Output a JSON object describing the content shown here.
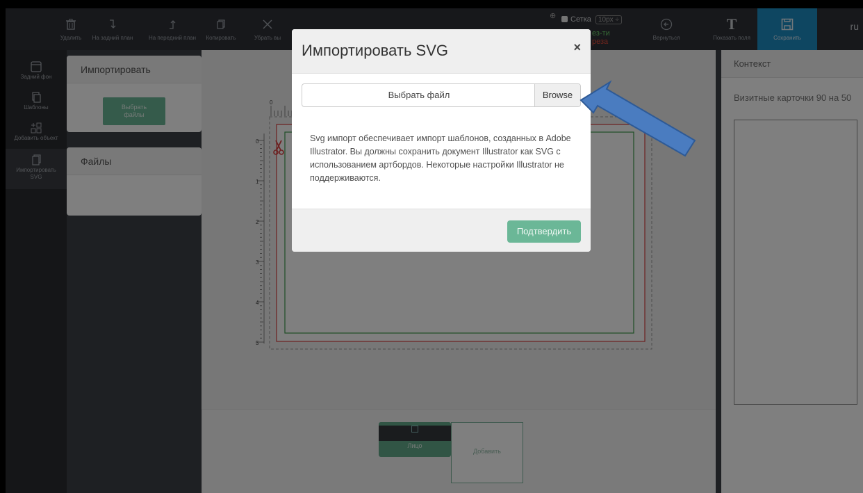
{
  "toolbar": {
    "delete": "Удалить",
    "to_back": "На задний план",
    "to_front": "На передний план",
    "copy": "Копировать",
    "remove": "Убрать вы",
    "grid_label": "Сетка",
    "grid_size": "10px ÷",
    "bleed_line1": "ез-ти",
    "bleed_line2": "реза",
    "bleed_colors": {
      "line1": "#6bd06b",
      "line2": "#e24a3b"
    },
    "back": "Вернуться",
    "show_fields": "Показать поля",
    "save": "Сохранить",
    "language": "ru"
  },
  "sidebar": {
    "items": [
      {
        "label": "Задний фон",
        "icon": "background-icon"
      },
      {
        "label": "Шаблоны",
        "icon": "templates-icon"
      },
      {
        "label": "Добавить объект",
        "icon": "add-object-icon"
      },
      {
        "label": "Импортировать SVG",
        "icon": "import-svg-icon"
      }
    ]
  },
  "left_panel": {
    "import_title": "Импортировать",
    "choose_files": "Выбрать файлы",
    "files_title": "Файлы"
  },
  "canvas": {
    "ruler_numbers": [
      "0",
      "1",
      "2",
      "3",
      "4",
      "5"
    ],
    "pages": [
      {
        "label": "Лицо"
      },
      {
        "label": "Добавить"
      }
    ]
  },
  "right_panel": {
    "title": "Контекст",
    "context_text": "Визитные карточки 90 на 50"
  },
  "modal": {
    "title": "Импортировать SVG",
    "close": "×",
    "file_placeholder": "Выбрать файл",
    "browse": "Browse",
    "body": "Svg импорт обеспечивает импорт шаблонов, созданных в Adobe Illustrator. Вы должны сохранить документ Illustrator как SVG с использованием артбордов. Некоторые настройки Illustrator не поддерживаются.",
    "confirm": "Подтвердить"
  },
  "colors": {
    "accent_green": "#6bb797",
    "save_blue": "#1d8cc3",
    "arrow_blue": "#4a7cc0",
    "cut_line": "#d94040",
    "safe_line": "#3d9a4a"
  }
}
